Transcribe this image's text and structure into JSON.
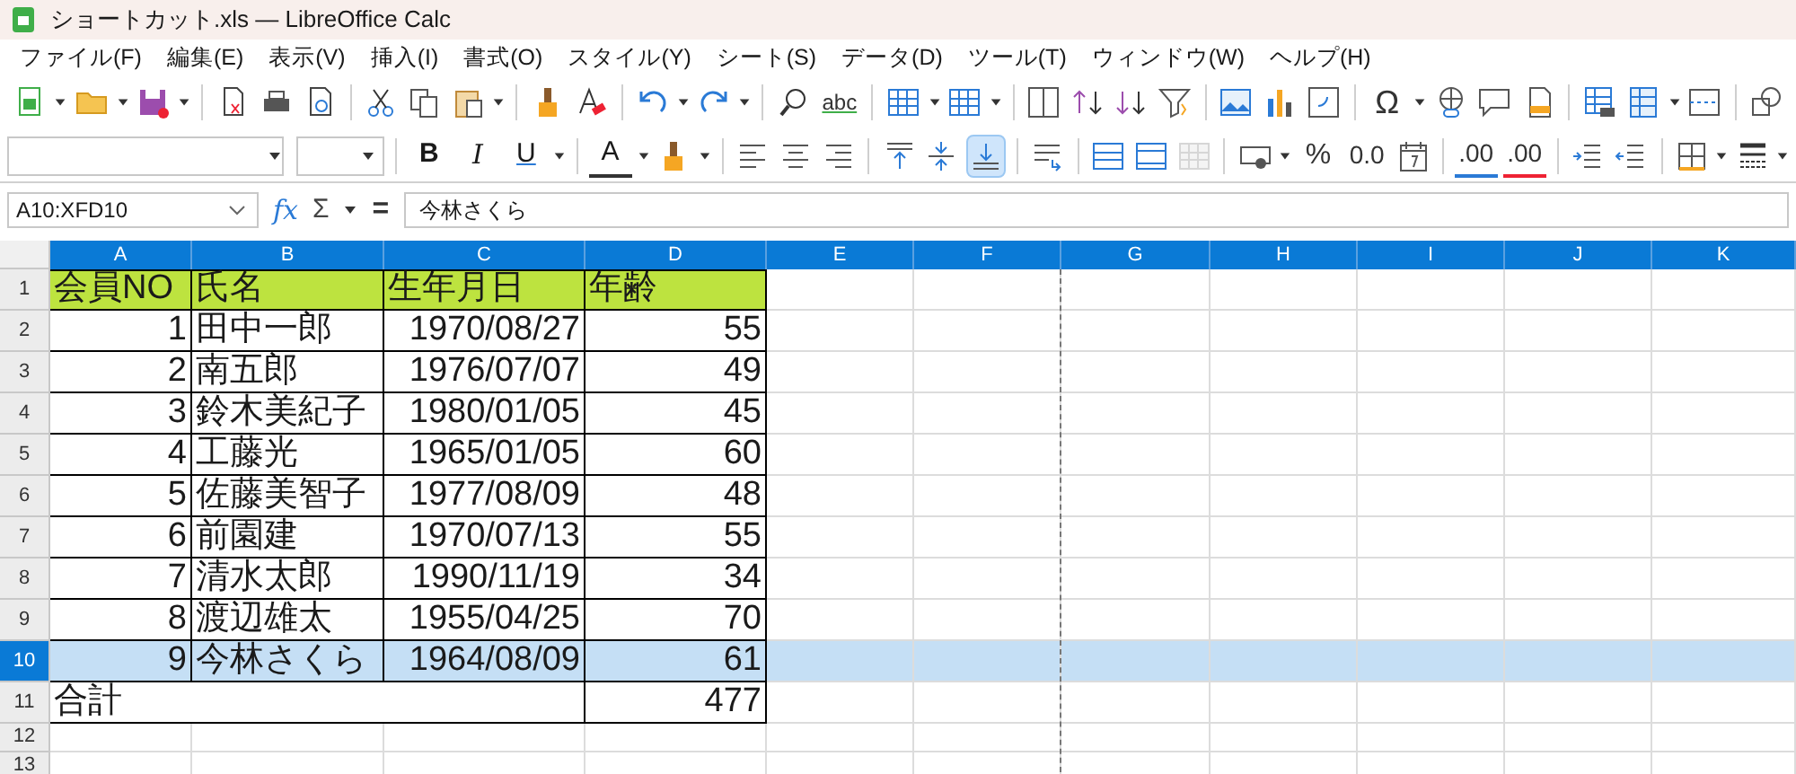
{
  "window": {
    "title": "ショートカット.xls — LibreOffice Calc"
  },
  "menu": [
    "ファイル(F)",
    "編集(E)",
    "表示(V)",
    "挿入(I)",
    "書式(O)",
    "スタイル(Y)",
    "シート(S)",
    "データ(D)",
    "ツール(T)",
    "ウィンドウ(W)",
    "ヘルプ(H)"
  ],
  "toolbar_texts": {
    "spellcheck": "abc",
    "special_character": "Ω",
    "bold": "B",
    "italic": "I",
    "underline": "U",
    "font_color": "A",
    "percent": "%",
    "standard_format": "0.0",
    "add_decimal": ".00",
    "delete_decimal": ".00"
  },
  "toolbar_states": {
    "align_bottom": {
      "selected": true
    },
    "unmerge": {
      "disabled": true
    }
  },
  "formula_bar": {
    "name_box": "A10:XFD10",
    "function_wizard": "fx",
    "sum": "Σ",
    "equals": "=",
    "content": "今林さくら"
  },
  "columns": [
    "A",
    "B",
    "C",
    "D",
    "E",
    "F",
    "G",
    "H",
    "I",
    "J",
    "K"
  ],
  "rows": [
    {
      "header": "1",
      "selected": false,
      "cells": [
        {
          "text": "会員NO",
          "kind": "text",
          "color": "#bde33f"
        },
        {
          "text": "氏名",
          "kind": "text",
          "color": "#bde33f"
        },
        {
          "text": "生年月日",
          "kind": "text",
          "color": "#bde33f"
        },
        {
          "text": "年齢",
          "kind": "text",
          "color": "#bde33f"
        }
      ]
    },
    {
      "header": "2",
      "selected": false,
      "cells": [
        {
          "text": "1",
          "kind": "number"
        },
        {
          "text": "田中一郎",
          "kind": "text"
        },
        {
          "text": "1970/08/27",
          "kind": "number"
        },
        {
          "text": "55",
          "kind": "number"
        }
      ]
    },
    {
      "header": "3",
      "selected": false,
      "cells": [
        {
          "text": "2",
          "kind": "number"
        },
        {
          "text": "南五郎",
          "kind": "text"
        },
        {
          "text": "1976/07/07",
          "kind": "number"
        },
        {
          "text": "49",
          "kind": "number"
        }
      ]
    },
    {
      "header": "4",
      "selected": false,
      "cells": [
        {
          "text": "3",
          "kind": "number"
        },
        {
          "text": "鈴木美紀子",
          "kind": "text"
        },
        {
          "text": "1980/01/05",
          "kind": "number"
        },
        {
          "text": "45",
          "kind": "number"
        }
      ]
    },
    {
      "header": "5",
      "selected": false,
      "cells": [
        {
          "text": "4",
          "kind": "number"
        },
        {
          "text": "工藤光",
          "kind": "text"
        },
        {
          "text": "1965/01/05",
          "kind": "number"
        },
        {
          "text": "60",
          "kind": "number"
        }
      ]
    },
    {
      "header": "6",
      "selected": false,
      "cells": [
        {
          "text": "5",
          "kind": "number"
        },
        {
          "text": "佐藤美智子",
          "kind": "text"
        },
        {
          "text": "1977/08/09",
          "kind": "number"
        },
        {
          "text": "48",
          "kind": "number"
        }
      ]
    },
    {
      "header": "7",
      "selected": false,
      "cells": [
        {
          "text": "6",
          "kind": "number"
        },
        {
          "text": "前園建",
          "kind": "text"
        },
        {
          "text": "1970/07/13",
          "kind": "number"
        },
        {
          "text": "55",
          "kind": "number"
        }
      ]
    },
    {
      "header": "8",
      "selected": false,
      "cells": [
        {
          "text": "7",
          "kind": "number"
        },
        {
          "text": "清水太郎",
          "kind": "text"
        },
        {
          "text": "1990/11/19",
          "kind": "number"
        },
        {
          "text": "34",
          "kind": "number"
        }
      ]
    },
    {
      "header": "9",
      "selected": false,
      "cells": [
        {
          "text": "8",
          "kind": "number"
        },
        {
          "text": "渡辺雄太",
          "kind": "text"
        },
        {
          "text": "1955/04/25",
          "kind": "number"
        },
        {
          "text": "70",
          "kind": "number"
        }
      ]
    },
    {
      "header": "10",
      "selected": true,
      "cells": [
        {
          "text": "9",
          "kind": "number"
        },
        {
          "text": "今林さくら",
          "kind": "text"
        },
        {
          "text": "1964/08/09",
          "kind": "number"
        },
        {
          "text": "61",
          "kind": "number"
        }
      ]
    },
    {
      "header": "11",
      "selected": false,
      "cells": [
        {
          "text": "合計",
          "kind": "text"
        },
        {
          "text": "477",
          "kind": "number"
        }
      ]
    },
    {
      "header": "12",
      "selected": false,
      "cells": []
    },
    {
      "header": "13",
      "selected": false,
      "cells": []
    }
  ]
}
